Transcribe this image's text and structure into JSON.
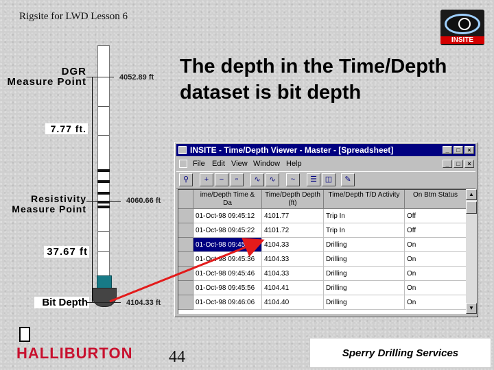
{
  "header": {
    "lesson": "Rigsite for LWD Lesson 6"
  },
  "logo": {
    "text": "INSITE"
  },
  "slide": {
    "title": "The depth in the Time/Depth dataset is bit depth",
    "page_number": "44"
  },
  "diagram": {
    "dgr_label_1": "DGR",
    "dgr_label_2": "Measure Point",
    "dgr_depth": "4052.89 ft",
    "gap1": "7.77 ft.",
    "res_label_1": "Resistivity",
    "res_label_2": "Measure Point",
    "res_depth": "4060.66 ft",
    "gap2": "37.67 ft",
    "bit_label": "Bit Depth",
    "bit_depth": "4104.33 ft"
  },
  "window": {
    "title": "INSITE - Time/Depth Viewer - Master - [Spreadsheet]",
    "menus": [
      "File",
      "Edit",
      "View",
      "Window",
      "Help"
    ],
    "columns": [
      "ime/Depth Time & Da",
      "Time/Depth Depth (ft)",
      "Time/Depth T/D Activity",
      "On Btm Status"
    ],
    "rows": [
      [
        "01-Oct-98 09:45:12",
        "4101.77",
        "Trip In",
        "Off"
      ],
      [
        "01-Oct-98 09:45:22",
        "4101.72",
        "Trip In",
        "Off"
      ],
      [
        "01-Oct-98 09:45:26",
        "4104.33",
        "Drilling",
        "On"
      ],
      [
        "01-Oct-98 09:45:36",
        "4104.33",
        "Drilling",
        "On"
      ],
      [
        "01-Oct-98 09:45:46",
        "4104.33",
        "Drilling",
        "On"
      ],
      [
        "01-Oct-98 09:45:56",
        "4104.41",
        "Drilling",
        "On"
      ],
      [
        "01-Oct-98 09:46:06",
        "4104.40",
        "Drilling",
        "On"
      ]
    ],
    "selected_row": 2
  },
  "footer": {
    "company": "HALLIBURTON",
    "division": "Sperry Drilling Services"
  },
  "colors": {
    "accent_red": "#e31b1b",
    "title_blue": "#000080",
    "halliburton_red": "#c8102e"
  }
}
